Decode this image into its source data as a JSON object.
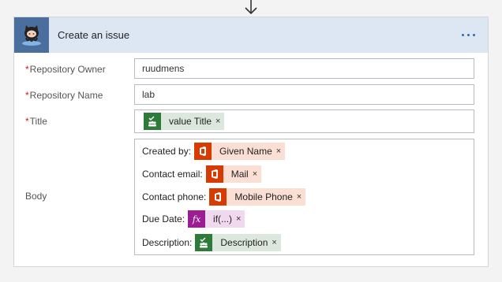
{
  "card": {
    "title": "Create an issue"
  },
  "fields": {
    "repo_owner": {
      "label": "Repository Owner",
      "required": "*",
      "value": "ruudmens"
    },
    "repo_name": {
      "label": "Repository Name",
      "required": "*",
      "value": "lab"
    },
    "title": {
      "label": "Title",
      "required": "*",
      "token": "value Title"
    },
    "body": {
      "label": "Body",
      "lines": [
        {
          "label": "Created by:",
          "token": "Given Name",
          "icon": "office-icon"
        },
        {
          "label": "Contact email:",
          "token": "Mail",
          "icon": "office-icon"
        },
        {
          "label": "Contact phone:",
          "token": "Mobile Phone",
          "icon": "office-icon"
        },
        {
          "label": "Due Date:",
          "token": "if(...)",
          "icon": "fx-icon",
          "icon_text": "fx"
        },
        {
          "label": "Description:",
          "token": "Description",
          "icon": "forms-icon"
        }
      ]
    }
  },
  "token_remove": "×",
  "colors": {
    "header_bg": "#dde7f4",
    "github_icon_bg": "#4a6e9e",
    "accent": "#2b6cb6",
    "required": "#c3202b",
    "forms_green": "#2e7a38",
    "office_orange": "#d83b01",
    "fx_purple": "#9c1c93"
  }
}
